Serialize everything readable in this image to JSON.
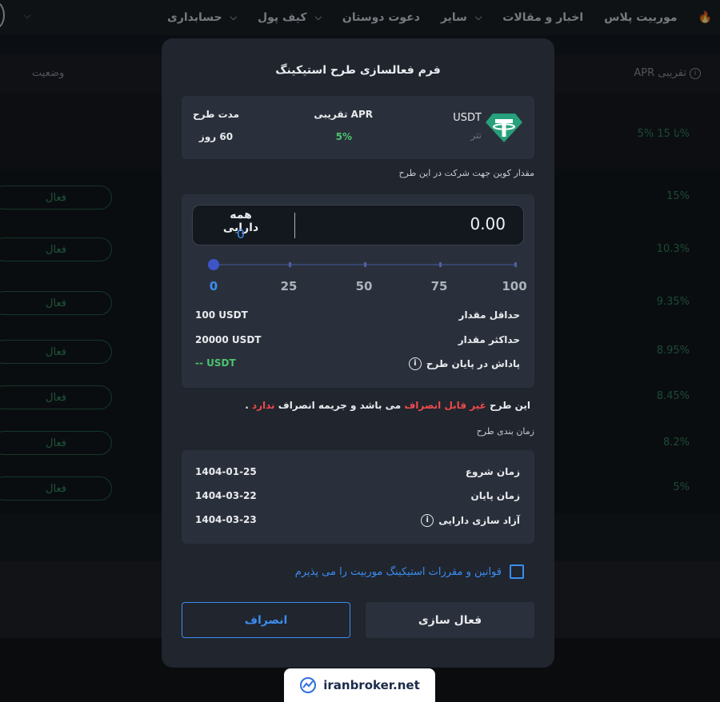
{
  "topnav": {
    "items": [
      {
        "label": "موربیت پلاس",
        "chevron": false
      },
      {
        "label": "اخبار و مقالات",
        "chevron": false
      },
      {
        "label": "سایر",
        "chevron": true
      },
      {
        "label": "دعوت دوستان",
        "chevron": false
      },
      {
        "label": "کیف پول",
        "chevron": true
      },
      {
        "label": "حسابداری",
        "chevron": true
      }
    ]
  },
  "table": {
    "status_header": "وضعیت",
    "apr_header": "APR تقریبی",
    "rows": [
      {
        "apr": "5% تا 15%",
        "status": ""
      },
      {
        "apr": "15%",
        "status": "فعال"
      },
      {
        "apr": "10.3%",
        "status": "فعال"
      },
      {
        "apr": "9.35%",
        "status": "فعال"
      },
      {
        "apr": "8.95%",
        "status": "فعال"
      },
      {
        "apr": "8.45%",
        "status": "فعال"
      },
      {
        "apr": "8.2%",
        "status": "فعال"
      },
      {
        "apr": "5%",
        "status": "فعال"
      }
    ]
  },
  "modal": {
    "title": "فرم فعالسازی طرح استیکینگ",
    "coin": {
      "symbol": "USDT",
      "name": "تتر"
    },
    "apr": {
      "label": "APR تقریبی",
      "value": "5%"
    },
    "duration": {
      "label": "مدت طرح",
      "value": "60 روز"
    },
    "amount_label": "مقدار کوین جهت شرکت در این طرح",
    "input": {
      "value": "0.00",
      "all_label": "همه دارایی",
      "all_value": "0"
    },
    "slider": {
      "value_percent": 0,
      "ticks": [
        "0",
        "25",
        "50",
        "75",
        "100"
      ]
    },
    "limits": {
      "min_label": "حداقل مقدار",
      "min_value": "100 USDT",
      "max_label": "حداکثر مقدار",
      "max_value": "20000 USDT",
      "reward_label": "پاداش در پایان طرح",
      "reward_value": "-- USDT"
    },
    "warning": {
      "p1": "این طرح",
      "p2": "غیر قابل انصراف",
      "p3": "می باشد و جریمه انصراف",
      "p4": "ندارد",
      "p5": "."
    },
    "schedule_label": "زمان بندی طرح",
    "schedule": {
      "start_label": "زمان شروع",
      "start_value": "1404-01-25",
      "end_label": "زمان پایان",
      "end_value": "1404-03-22",
      "release_label": "آزاد سازی دارایی",
      "release_value": "1404-03-23"
    },
    "terms_label": "قوانین و مقررات استیکینگ موربیت را می پذیرم",
    "activate_label": "فعال سازی",
    "cancel_label": "انصراف"
  },
  "watermark": {
    "text": "iranbroker.net"
  },
  "colors": {
    "accent": "#3b8df0",
    "success": "#4cc46f",
    "danger": "#ef4a4a",
    "tether": "#26a17b"
  }
}
